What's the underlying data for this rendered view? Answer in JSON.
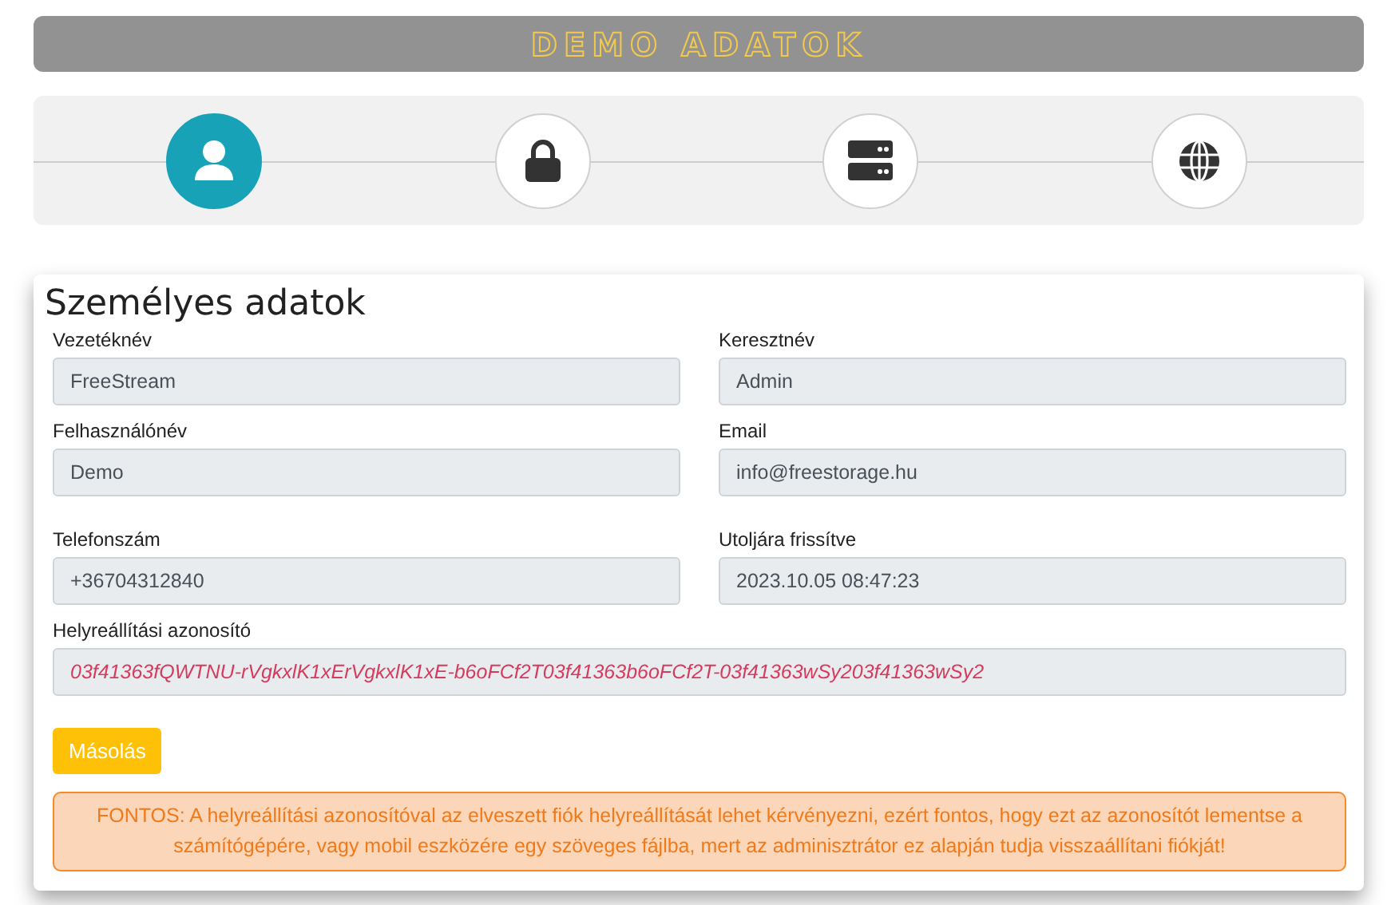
{
  "banner": {
    "title": "DEMO ADATOK"
  },
  "steps": [
    {
      "kind": "user",
      "selected": true
    },
    {
      "kind": "lock",
      "selected": false
    },
    {
      "kind": "server",
      "selected": false
    },
    {
      "kind": "globe",
      "selected": false
    }
  ],
  "form": {
    "title": "Személyes adatok",
    "fields": [
      {
        "label": "Vezetéknév",
        "value": "FreeStream"
      },
      {
        "label": "Keresztnév",
        "value": "Admin"
      },
      {
        "label": "Felhasználónév",
        "value": "Demo"
      },
      {
        "label": "Email",
        "value": "info@freestorage.hu"
      },
      {
        "label": "Telefonszám",
        "value": "+36704312840"
      },
      {
        "label": "Utoljára frissítve",
        "value": "2023.10.05 08:47:23"
      }
    ],
    "recovery": {
      "label": "Helyreállítási azonosító",
      "value": "03f41363fQWTNU-rVgkxlK1xErVgkxlK1xE-b6oFCf2T03f41363b6oFCf2T-03f41363wSy203f41363wSy2"
    },
    "copy_button": "Másolás",
    "notice": "FONTOS: A helyreállítási azonosítóval az elveszett fiók helyreállítását lehet kérvényezni, ezért fontos, hogy ezt az azonosítót lementse a számítógépére, vagy mobil eszközére egy szöveges fájlba, mert az adminisztrátor ez alapján tudja visszaállítani fiókját!"
  }
}
